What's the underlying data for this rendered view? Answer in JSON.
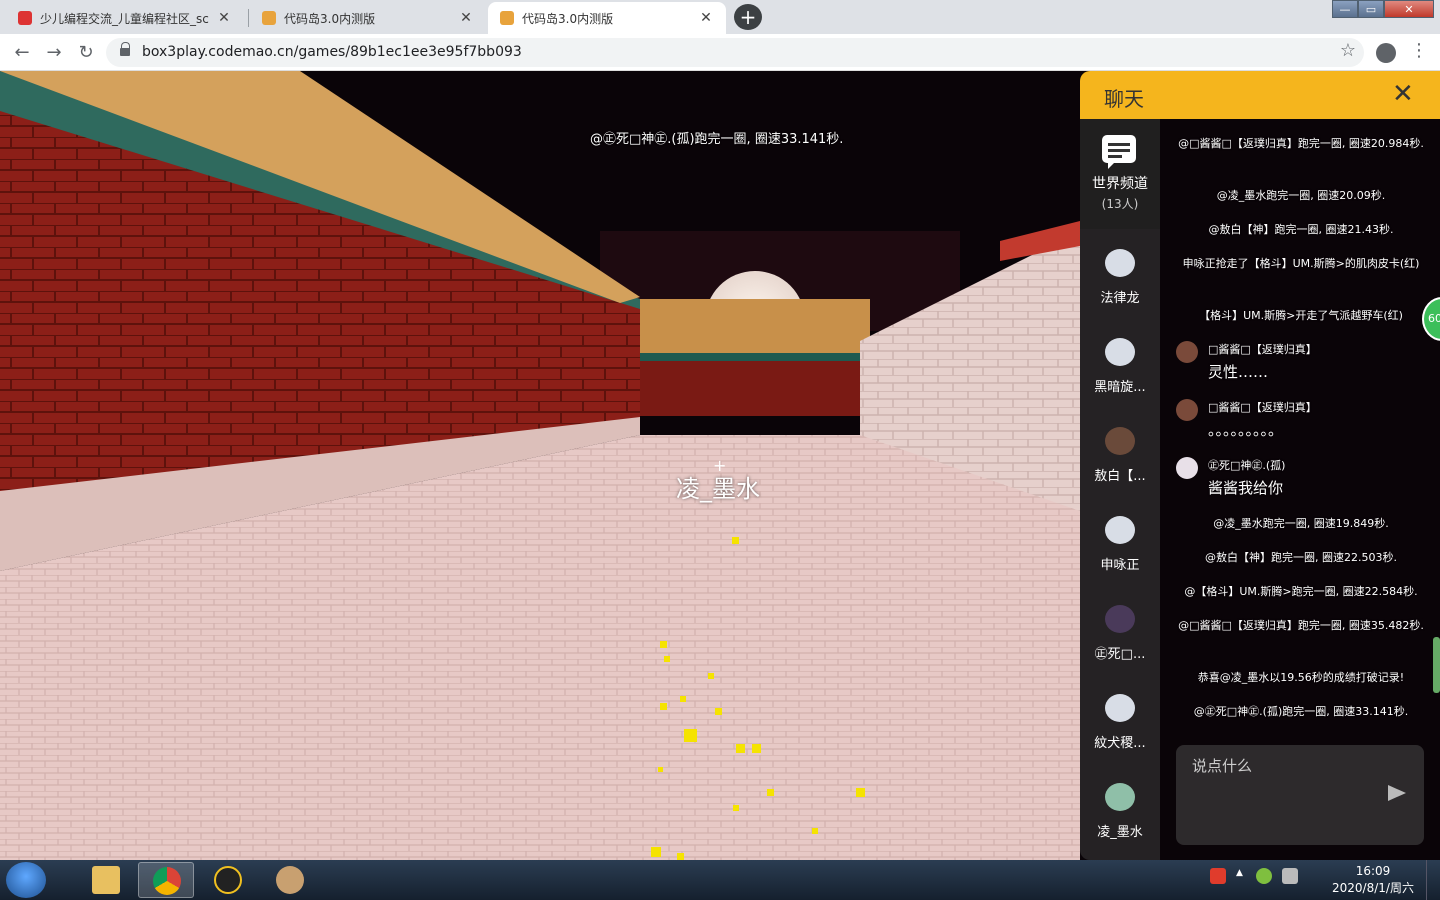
{
  "browser": {
    "tabs": [
      {
        "title": "少儿编程交流_儿童编程社区_sc",
        "favicon_color": "#d33"
      },
      {
        "title": "代码岛3.0内测版",
        "favicon_color": "#e8a33c"
      },
      {
        "title": "代码岛3.0内测版",
        "favicon_color": "#e8a33c"
      }
    ],
    "tab_close": "✕",
    "new_tab": "+",
    "url": "box3play.codemao.cn/games/89b1ec1ee3e95f7bb093",
    "window_controls": {
      "minimize": "—",
      "maximize": "▭",
      "close": "✕"
    }
  },
  "game": {
    "notice": "@㊣死□神㊣.(孤)跑完一圈, 圈速33.141秒.",
    "player_name": "凌_墨水",
    "crosshair": "+"
  },
  "chat": {
    "title": "聊天",
    "close": "✕",
    "channel": {
      "name": "世界频道",
      "count": "(13人)"
    },
    "users": [
      {
        "name": "法律龙",
        "avatar_color": "#d8dde6"
      },
      {
        "name": "黑暗旋...",
        "avatar_color": "#d8dde6"
      },
      {
        "name": "敖白【...",
        "avatar_color": "#6a4a3a"
      },
      {
        "name": "申咏正",
        "avatar_color": "#d8dde6"
      },
      {
        "name": "㊣死□...",
        "avatar_color": "#4a3a5a"
      },
      {
        "name": "紋犬稷...",
        "avatar_color": "#d8dde6"
      },
      {
        "name": "凌_墨水",
        "avatar_color": "#8fbfa8"
      }
    ],
    "messages": [
      {
        "type": "system",
        "text": "@□酱酱□【返璞归真】跑完一圈, 圈速20.984秒."
      },
      {
        "type": "system",
        "text": "@凌_墨水跑完一圈, 圈速20.09秒."
      },
      {
        "type": "system",
        "text": "@敖白【神】跑完一圈, 圈速21.43秒."
      },
      {
        "type": "system",
        "text": "申咏正抢走了【格斗】UM.斯腾>的肌肉皮卡(红)"
      },
      {
        "type": "system",
        "text": "【格斗】UM.斯腾>开走了气派越野车(红)"
      },
      {
        "type": "user",
        "who": "□酱酱□【返璞归真】",
        "text": "灵性……",
        "avatar_color": "#7a4a3a"
      },
      {
        "type": "user",
        "who": "□酱酱□【返璞归真】",
        "text": "。。。。。。。。。",
        "avatar_color": "#7a4a3a"
      },
      {
        "type": "user",
        "who": "㊣死□神㊣.(孤)",
        "text": "酱酱我给你",
        "avatar_color": "#e8e0e8"
      },
      {
        "type": "system",
        "text": "@凌_墨水跑完一圈, 圈速19.849秒."
      },
      {
        "type": "system",
        "text": "@敖白【神】跑完一圈, 圈速22.503秒."
      },
      {
        "type": "system",
        "text": "@【格斗】UM.斯腾>跑完一圈, 圈速22.584秒."
      },
      {
        "type": "system",
        "text": "@□酱酱□【返璞归真】跑完一圈, 圈速35.482秒."
      },
      {
        "type": "system",
        "text": "恭喜@凌_墨水以19.56秒的成绩打破记录!"
      },
      {
        "type": "system",
        "text": "@㊣死□神㊣.(孤)跑完一圈, 圈速33.141秒."
      }
    ],
    "input_placeholder": "说点什么",
    "badge": "60"
  },
  "taskbar": {
    "time": "16:09",
    "date": "2020/8/1/周六",
    "tray_arrow": "▲"
  }
}
